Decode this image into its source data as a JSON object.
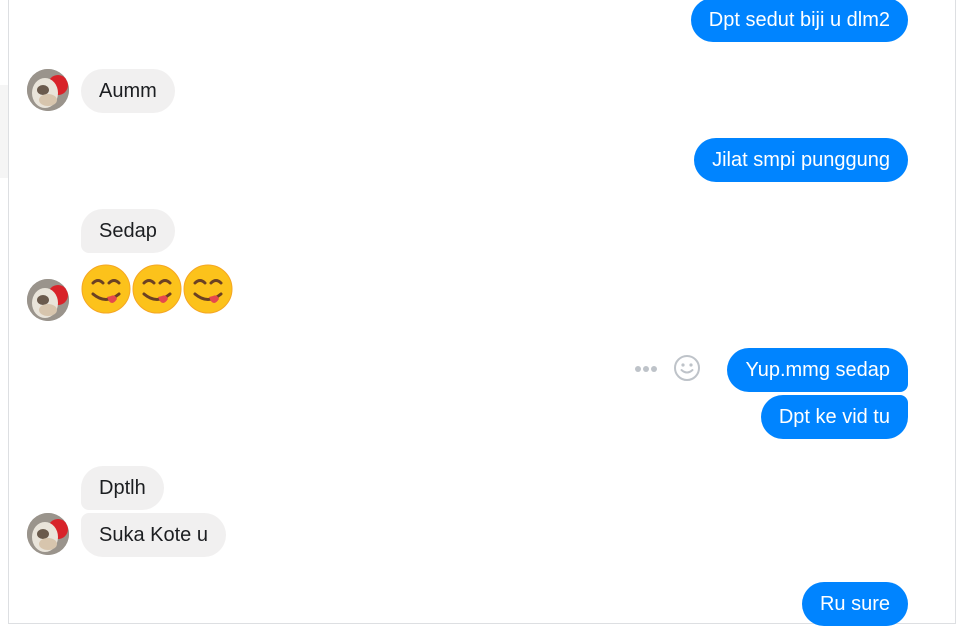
{
  "conversation": {
    "messages": [
      {
        "direction": "outgoing",
        "text": "Dpt sedut biji u dlm2"
      },
      {
        "direction": "incoming",
        "text": "Aumm"
      },
      {
        "direction": "outgoing",
        "text": "Jilat smpi punggung"
      },
      {
        "direction": "incoming",
        "text": "Sedap"
      },
      {
        "direction": "incoming",
        "emoji": [
          "face-savoring-food",
          "face-savoring-food",
          "face-savoring-food"
        ]
      },
      {
        "direction": "outgoing",
        "text": "Yup.mmg sedap"
      },
      {
        "direction": "outgoing",
        "text": "Dpt ke vid tu"
      },
      {
        "direction": "incoming",
        "text": "Dptlh"
      },
      {
        "direction": "incoming",
        "text": "Suka Kote u"
      },
      {
        "direction": "outgoing",
        "text": "Ru sure"
      }
    ]
  },
  "message_actions": {
    "icons": [
      "more-options-icon",
      "react-smiley-icon"
    ]
  },
  "colors": {
    "outgoing_bubble": "#0084ff",
    "incoming_bubble": "#f1f0f0",
    "outgoing_text": "#ffffff",
    "incoming_text": "#1c1e21"
  }
}
